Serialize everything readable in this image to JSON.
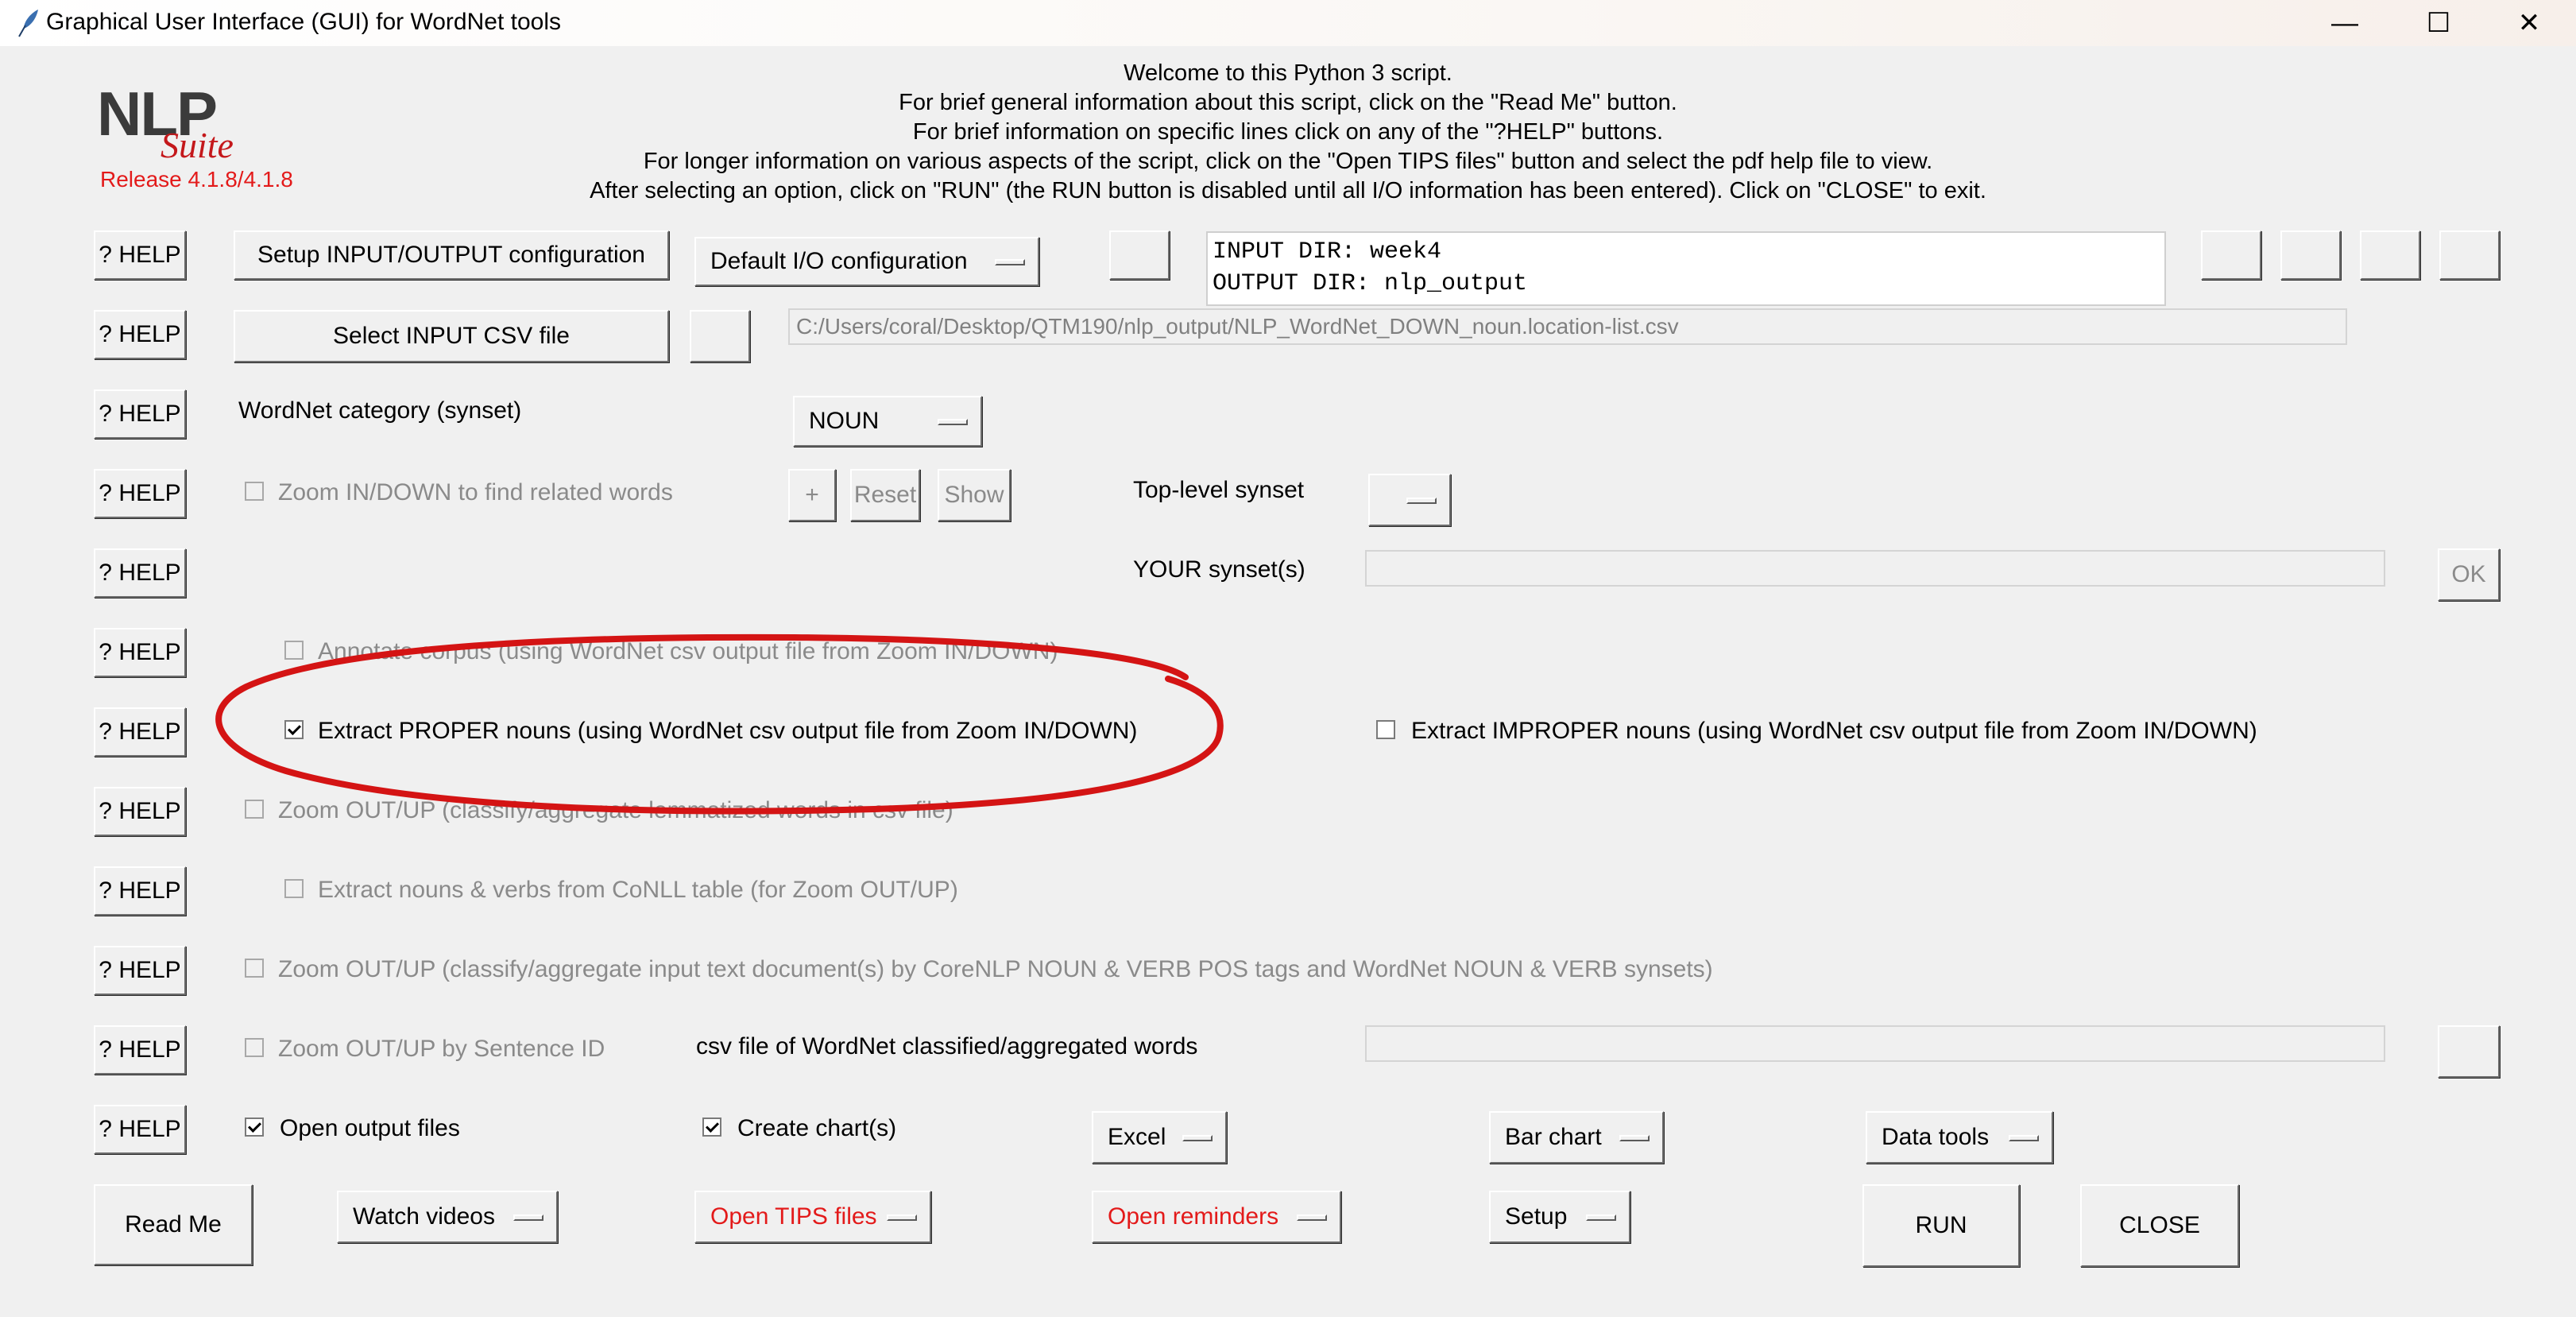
{
  "window": {
    "title": "Graphical User Interface (GUI) for WordNet tools",
    "controls": {
      "minimize": "—",
      "maximize": "☐",
      "close": "✕"
    }
  },
  "logo": {
    "nlp": "NLP",
    "suite": "Suite",
    "release": "Release 4.1.8/4.1.8"
  },
  "welcome": [
    "Welcome to this Python 3 script.",
    "For brief general information about this script, click on the \"Read Me\" button.",
    "For brief information on specific lines click on any of the \"?HELP\" buttons.",
    "For longer information on various aspects of the script, click on the \"Open TIPS files\" button and select the pdf help file to view.",
    "After selecting an option, click on \"RUN\" (the RUN button is disabled until all I/O information has been entered).   Click on \"CLOSE\" to exit."
  ],
  "help_label": "? HELP",
  "io": {
    "setup_button": "Setup INPUT/OUTPUT configuration",
    "config_menu": "Default I/O configuration",
    "display_input": "INPUT DIR: week4",
    "display_output": "OUTPUT DIR: nlp_output",
    "select_csv_button": "Select INPUT CSV file",
    "csv_path": "C:/Users/coral/Desktop/QTM190/nlp_output/NLP_WordNet_DOWN_noun.location-list.csv"
  },
  "wordnet_category": {
    "label": "WordNet category (synset)",
    "value": "NOUN"
  },
  "zoom_in": {
    "label": "Zoom IN/DOWN to find related words",
    "checked": false,
    "plus": "+",
    "reset": "Reset",
    "show": "Show",
    "top_level_label": "Top-level synset",
    "your_synsets_label": "YOUR synset(s)",
    "ok": "OK"
  },
  "annotate": {
    "label": "Annotate corpus (using WordNet csv output file from Zoom IN/DOWN)",
    "checked": false
  },
  "extract_proper": {
    "label": "Extract PROPER nouns  (using WordNet csv output file from Zoom IN/DOWN)",
    "checked": true
  },
  "extract_improper": {
    "label": "Extract IMPROPER nouns  (using WordNet csv output file from Zoom IN/DOWN)",
    "checked": false
  },
  "zoom_out_lemma": {
    "label": "Zoom OUT/UP (classify/aggregate lemmatized words in csv file)",
    "checked": false
  },
  "extract_conll": {
    "label": "Extract nouns & verbs from CoNLL table (for Zoom OUT/UP)",
    "checked": false
  },
  "zoom_out_text": {
    "label": "Zoom OUT/UP (classify/aggregate input text document(s) by CoreNLP NOUN & VERB POS tags and WordNet NOUN & VERB synsets)",
    "checked": false
  },
  "zoom_out_sentence": {
    "label": "Zoom OUT/UP by Sentence ID",
    "checked": false,
    "csv_label": "csv file of WordNet classified/aggregated words"
  },
  "output": {
    "open_files": "Open output files",
    "open_checked": true,
    "create_charts": "Create chart(s)",
    "charts_checked": true,
    "excel_menu": "Excel",
    "bar_chart_menu": "Bar chart",
    "data_tools_menu": "Data tools"
  },
  "bottom": {
    "read_me": "Read Me",
    "watch_videos": "Watch videos",
    "open_tips": "Open TIPS files",
    "open_reminders": "Open reminders",
    "setup": "Setup",
    "run": "RUN",
    "close": "CLOSE"
  },
  "colors": {
    "accent_red": "#e31a1a",
    "annotation_red": "#d41414",
    "background": "#f0f0f0"
  }
}
